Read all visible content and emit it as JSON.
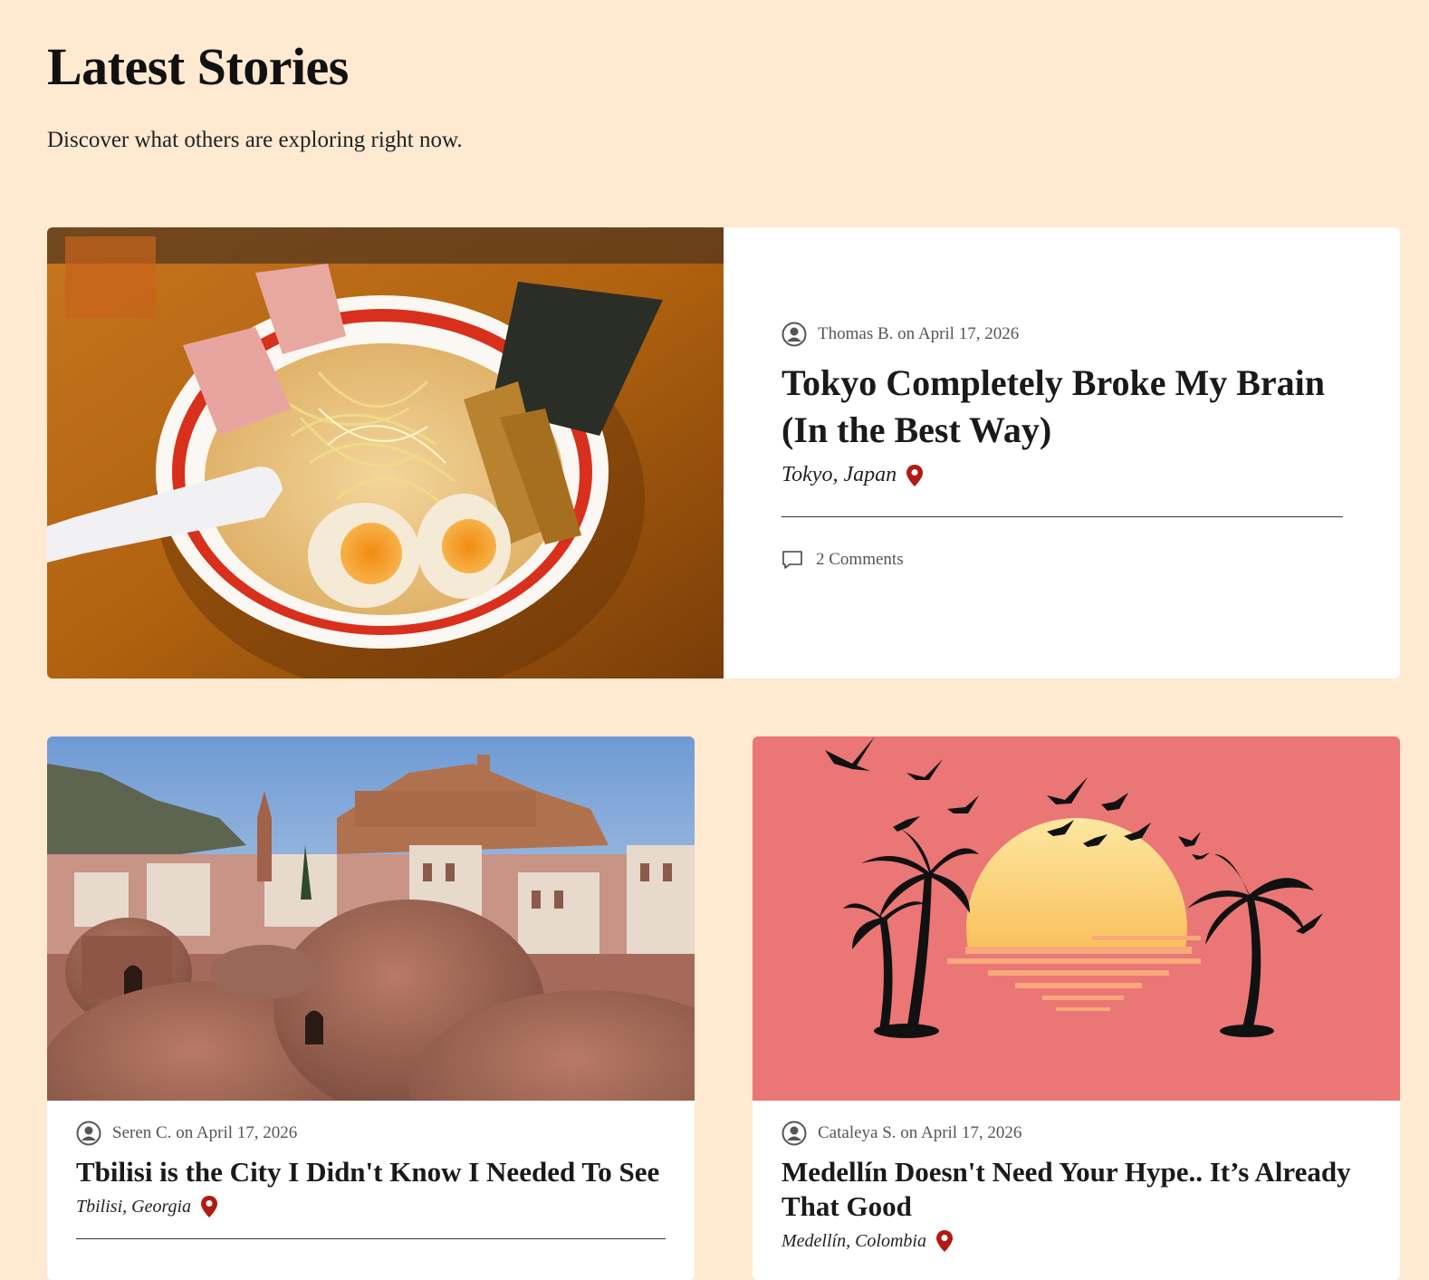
{
  "header": {
    "title": "Latest Stories",
    "subtitle": "Discover what others are exploring right now."
  },
  "colors": {
    "page_background": "#ffe9d1",
    "card_background": "#ffffff",
    "pin_red": "#b21a14",
    "sunset_background": "#ea7676"
  },
  "stories": [
    {
      "author": "Thomas B.",
      "date_line": "on April 17, 2026",
      "title": "Tokyo Completely Broke My Brain (In the Best Way)",
      "location": "Tokyo, Japan",
      "comments": "2 Comments",
      "image": "ramen-bowl-photo"
    },
    {
      "author": "Seren C.",
      "date_line": "on April 17, 2026",
      "title": "Tbilisi is the City I Didn't Know I Needed To See",
      "location": "Tbilisi, Georgia",
      "image": "tbilisi-bathhouse-domes-photo"
    },
    {
      "author": "Cataleya S.",
      "date_line": "on April 17, 2026",
      "title": "Medellín Doesn't Need Your Hype.. It’s Already That Good",
      "location": "Medellín, Colombia",
      "image": "sunset-palms-illustration"
    }
  ]
}
